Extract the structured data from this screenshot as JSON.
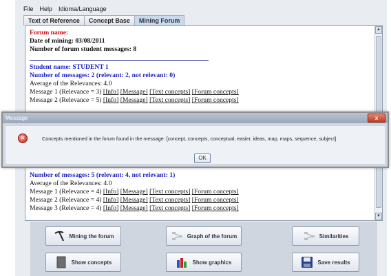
{
  "menu": [
    "File",
    "Help",
    "Idioma/Language"
  ],
  "tabs": [
    {
      "label": "Text of Reference",
      "active": false
    },
    {
      "label": "Concept Base",
      "active": false
    },
    {
      "label": "Mining Forum",
      "active": true
    }
  ],
  "content": {
    "forum_name": "Forum name:",
    "date_of_mining": "Date of mining: 03/08/2011",
    "num_messages": "Number of forum student messages: 8",
    "student1": {
      "name": "Student name: STUDENT 1",
      "messages": "Number of messages: 2 (relevant: 2, not relevant: 0)",
      "average": "Average of the Relevances: 4.0",
      "rows": [
        {
          "label": "Message 1 (Relevance = 3)"
        },
        {
          "label": "Message 2 (Relevance = 5)"
        }
      ]
    },
    "student2": {
      "messages": "Number of messages: 5 (relevant: 4, not relevant: 1)",
      "average": "Average of the Relevances: 4.0",
      "rows": [
        {
          "label": "Message 1 (Relevance = 4)"
        },
        {
          "label": "Message 2 (Relevance = 4)"
        },
        {
          "label": "Message 3 (Relevance = 4)"
        }
      ]
    },
    "links": {
      "info": "[Info]",
      "message": "[Message]",
      "text_concepts": "[Text concepts]",
      "forum_concepts": "[Forum concepts]"
    }
  },
  "buttons": {
    "mining": "Mining the forum",
    "graph": "Graph of the forum",
    "similarities": "Similarities",
    "concepts": "Show  concepts",
    "graphics": "Show  graphics",
    "save": "Save results"
  },
  "dialog": {
    "title": "Message",
    "close": "x",
    "icon": "error-icon",
    "message": "Concepts mentioned in the forum found in the message: [concept, concepts, conceptual, easier, ideas, map, maps, sequence, subject]",
    "ok": "OK"
  },
  "colors": {
    "forum_name": "#c8121a",
    "student": "#1a1ec8",
    "tab_active": "#c9d9ee",
    "close_button": "#c23a22"
  }
}
